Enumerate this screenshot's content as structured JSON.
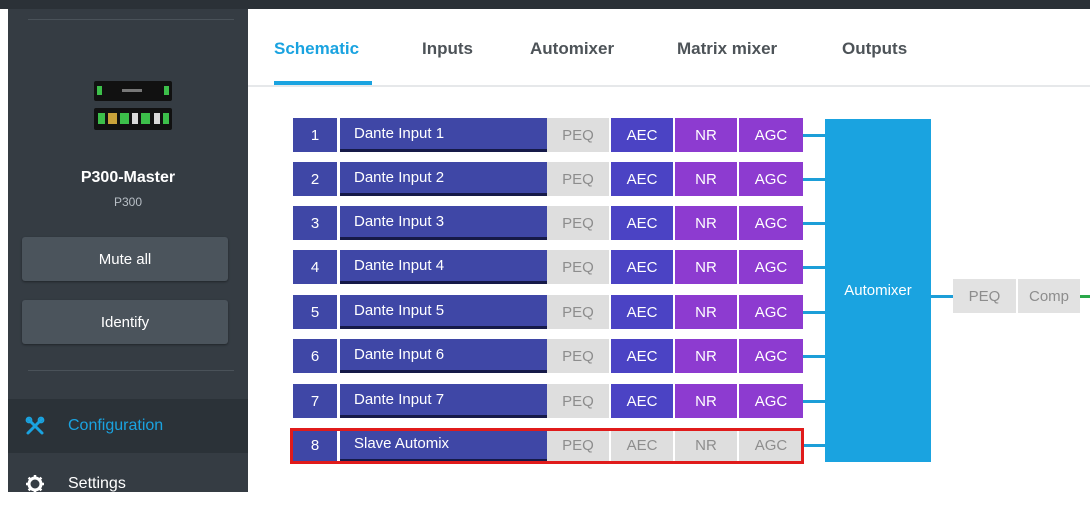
{
  "device": {
    "name": "P300-Master",
    "model": "P300"
  },
  "sidebar": {
    "mute_all_label": "Mute all",
    "identify_label": "Identify",
    "nav": [
      {
        "label": "Configuration",
        "icon": "tools-icon",
        "active": true
      },
      {
        "label": "Settings",
        "icon": "gear-icon",
        "active": false
      }
    ]
  },
  "tabs": [
    {
      "label": "Schematic",
      "active": true
    },
    {
      "label": "Inputs",
      "active": false
    },
    {
      "label": "Automixer",
      "active": false
    },
    {
      "label": "Matrix mixer",
      "active": false
    },
    {
      "label": "Outputs",
      "active": false
    }
  ],
  "schematic": {
    "block_labels": {
      "peq": "PEQ",
      "aec": "AEC",
      "nr": "NR",
      "agc": "AGC"
    },
    "inputs": [
      {
        "num": "1",
        "name": "Dante Input 1",
        "processing_enabled": true
      },
      {
        "num": "2",
        "name": "Dante Input 2",
        "processing_enabled": true
      },
      {
        "num": "3",
        "name": "Dante Input 3",
        "processing_enabled": true
      },
      {
        "num": "4",
        "name": "Dante Input 4",
        "processing_enabled": true
      },
      {
        "num": "5",
        "name": "Dante Input 5",
        "processing_enabled": true
      },
      {
        "num": "6",
        "name": "Dante Input 6",
        "processing_enabled": true
      },
      {
        "num": "7",
        "name": "Dante Input 7",
        "processing_enabled": true
      },
      {
        "num": "8",
        "name": "Slave Automix",
        "processing_enabled": false,
        "highlighted": true
      }
    ],
    "automixer_label": "Automixer",
    "output_blocks": {
      "peq": "PEQ",
      "comp": "Comp"
    }
  },
  "colors": {
    "accent": "#1aa3e0",
    "input_blue": "#3f47a6",
    "aec": "#4b43c4",
    "nr_agc": "#8d3bd0",
    "disabled": "#dedede",
    "highlight": "#e01b1b",
    "sidebar": "#353c43"
  }
}
